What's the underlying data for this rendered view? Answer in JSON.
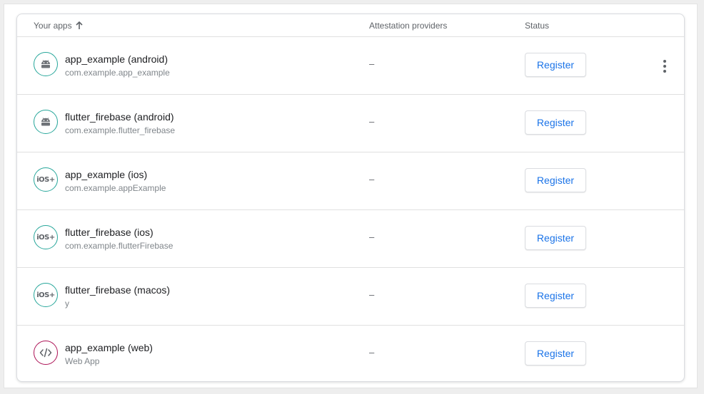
{
  "table": {
    "headers": {
      "apps": "Your apps",
      "attestation": "Attestation providers",
      "status": "Status"
    },
    "rows": [
      {
        "name": "app_example (android)",
        "bundle": "com.example.app_example",
        "platform": "android-icon",
        "attestation": "–",
        "action": "Register"
      },
      {
        "name": "flutter_firebase (android)",
        "bundle": "com.example.flutter_firebase",
        "platform": "android-icon",
        "attestation": "–",
        "action": "Register"
      },
      {
        "name": "app_example (ios)",
        "bundle": "com.example.appExample",
        "platform": "ios-icon",
        "attestation": "–",
        "action": "Register"
      },
      {
        "name": "flutter_firebase (ios)",
        "bundle": "com.example.flutterFirebase",
        "platform": "ios-icon",
        "attestation": "–",
        "action": "Register"
      },
      {
        "name": "flutter_firebase (macos)",
        "bundle": "y",
        "platform": "ios-icon",
        "attestation": "–",
        "action": "Register"
      },
      {
        "name": "app_example (web)",
        "bundle": "Web App",
        "platform": "web-code-icon",
        "attestation": "–",
        "action": "Register"
      }
    ],
    "ios_label": "iOS+"
  },
  "colors": {
    "accent": "#1a73e8",
    "android_ring": "#26a69a",
    "web_ring": "#ad1457"
  }
}
